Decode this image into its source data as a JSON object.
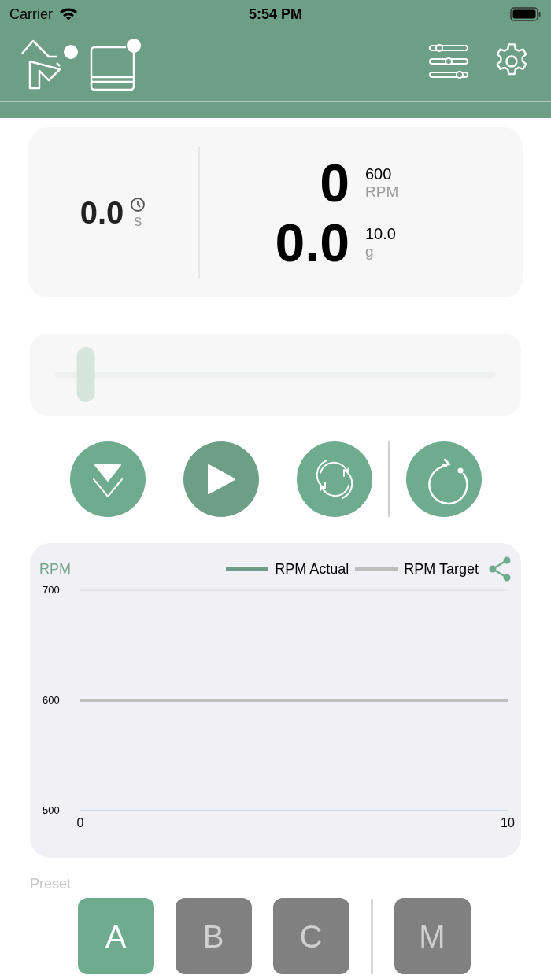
{
  "status_bar": {
    "carrier": "Carrier",
    "time": "5:54 PM"
  },
  "readout": {
    "time": {
      "value": "0.0",
      "unit": "s"
    },
    "speed": {
      "value": "0",
      "target": "600",
      "unit": "RPM"
    },
    "weight": {
      "value": "0.0",
      "target": "10.0",
      "unit": "g"
    }
  },
  "slider": {
    "level": 0.07
  },
  "controls": [
    {
      "kind": "drain"
    },
    {
      "kind": "play"
    },
    {
      "kind": "cycle"
    },
    {
      "kind": "restart"
    }
  ],
  "chart": {
    "chart_data": {
      "type": "line",
      "ylabel": "RPM",
      "x": [
        0,
        10
      ],
      "xlim": [
        0,
        10
      ],
      "ylim": [
        500,
        700
      ],
      "xticks": [
        0,
        10
      ],
      "yticks": [
        500,
        600,
        700
      ],
      "series": [
        {
          "name": "RPM Actual",
          "color": "#6e9e87",
          "values": [
            null,
            null
          ]
        },
        {
          "name": "RPM Target",
          "color": "#bdbdbd",
          "values": [
            600,
            600
          ]
        }
      ]
    }
  },
  "preset": {
    "label": "Preset",
    "buttons": [
      {
        "label": "A",
        "selected": true
      },
      {
        "label": "B",
        "selected": false
      },
      {
        "label": "C",
        "selected": false
      },
      {
        "label": "M",
        "selected": false
      }
    ]
  }
}
